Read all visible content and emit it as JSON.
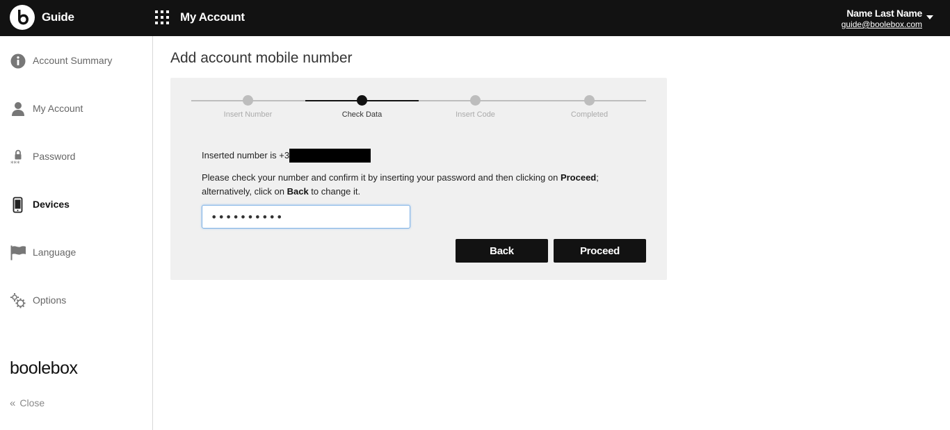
{
  "header": {
    "app_name": "Guide",
    "section_title": "My Account",
    "user_name": "Name Last Name",
    "user_email": "guide@boolebox.com"
  },
  "sidebar": {
    "items": [
      {
        "label": "Account Summary",
        "icon": "info-icon"
      },
      {
        "label": "My Account",
        "icon": "user-icon"
      },
      {
        "label": "Password",
        "icon": "lock-icon"
      },
      {
        "label": "Devices",
        "icon": "smartphone-icon",
        "active": true
      },
      {
        "label": "Language",
        "icon": "flag-icon"
      },
      {
        "label": "Options",
        "icon": "gears-icon"
      }
    ],
    "brand": "boolebox",
    "close_label": "Close"
  },
  "main": {
    "page_title": "Add account mobile number",
    "steps": [
      {
        "label": "Insert Number",
        "active": false
      },
      {
        "label": "Check Data",
        "active": true
      },
      {
        "label": "Insert Code",
        "active": false
      },
      {
        "label": "Completed",
        "active": false
      }
    ],
    "inserted_prefix": "Inserted number is +3",
    "instructions": {
      "part1": "Please check your number and confirm it by inserting your password and then clicking on ",
      "proceed_word": "Proceed",
      "part2": "; alternatively, click on ",
      "back_word": "Back",
      "part3": " to change it."
    },
    "password_value": "••••••••••",
    "back_label": "Back",
    "proceed_label": "Proceed"
  },
  "colors": {
    "topbar": "#121212",
    "panel": "#f0f0f0",
    "active_step": "#111111",
    "inactive_step": "#bdbdbd",
    "input_focus": "#7fb2e5"
  }
}
